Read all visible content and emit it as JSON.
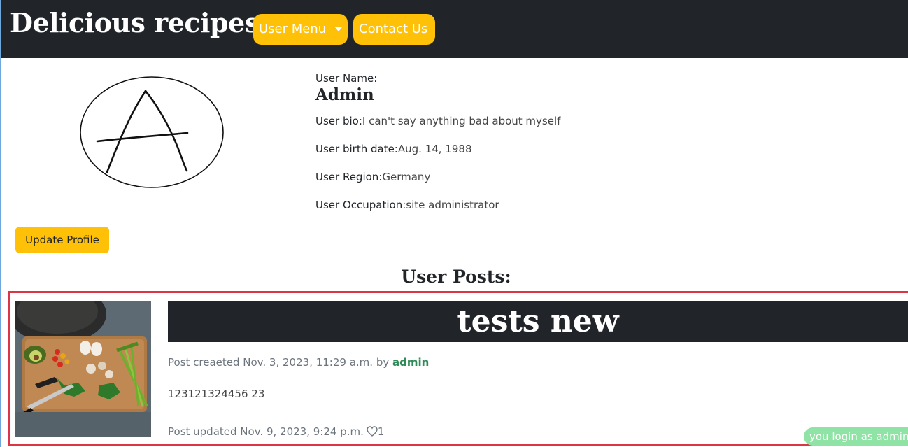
{
  "navbar": {
    "brand": "Delicious recipes",
    "user_menu_label": "User Menu",
    "contact_label": "Contact Us"
  },
  "profile": {
    "username_label": "User Name:",
    "username": "Admin",
    "bio_label": "User bio:",
    "bio": "I can't say anything bad about myself",
    "birth_label": "User birth date:",
    "birth": "Aug. 14, 1988",
    "region_label": "User Region:",
    "region": "Germany",
    "occupation_label": "User Occupation:",
    "occupation": "site administrator",
    "update_button": "Update Profile"
  },
  "posts": {
    "heading": "User Posts:",
    "items": [
      {
        "title": "tests new",
        "created_prefix": "Post creaeted Nov. 3, 2023, 11:29 a.m. by",
        "author": "admin",
        "body": "123121324456 23",
        "updated": "Post updated Nov. 9, 2023, 9:24 p.m.",
        "likes": "1"
      }
    ]
  },
  "status": {
    "login_badge": "you login as admin"
  },
  "colors": {
    "navbar_bg": "#212529",
    "accent": "#ffc107",
    "highlight_border": "#dc3545",
    "author_link": "#2e8b57",
    "badge": "#8fe3a4"
  },
  "icons": {
    "dropdown": "caret-down-icon",
    "like": "heart-icon"
  }
}
